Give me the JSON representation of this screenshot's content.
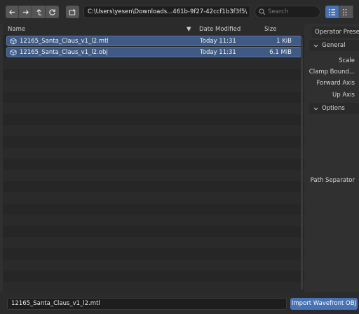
{
  "toolbar": {
    "path": "C:\\Users\\yesen\\Downloads...461b-9f27-42ccf1b3f3f5\\",
    "search_placeholder": "Search",
    "nav_icons": [
      "back-arrow-icon",
      "forward-arrow-icon",
      "parent-directory-icon",
      "refresh-icon"
    ],
    "new_folder_icon": "new-folder-icon",
    "view_icons": [
      "list-view-icon",
      "thumbnail-view-icon"
    ]
  },
  "file_list": {
    "columns": {
      "name": "Name",
      "date": "Date Modified",
      "size": "Size"
    },
    "files": [
      {
        "name": "12165_Santa_Claus_v1_l2.mtl",
        "date": "Today 11:31",
        "size": "1 KiB",
        "icon": "3d-object-icon"
      },
      {
        "name": "12165_Santa_Claus_v1_l2.obj",
        "date": "Today 11:31",
        "size": "6.1 MiB",
        "icon": "3d-object-icon"
      }
    ]
  },
  "sidepanel": {
    "operator_presets": "Operator Presets",
    "general_label": "General",
    "scale_label": "Scale",
    "clamp_label": "Clamp Bound...",
    "forward_axis_label": "Forward Axis",
    "up_axis_label": "Up Axis",
    "options_label": "Options",
    "path_separator_label": "Path Separator"
  },
  "bottom": {
    "filename": "12165_Santa_Claus_v1_l2.mtl",
    "import_label": "Import Wavefront OBJ"
  },
  "colors": {
    "accent": "#4772b3",
    "selected_row": "#3f5a84",
    "background": "#303030"
  }
}
